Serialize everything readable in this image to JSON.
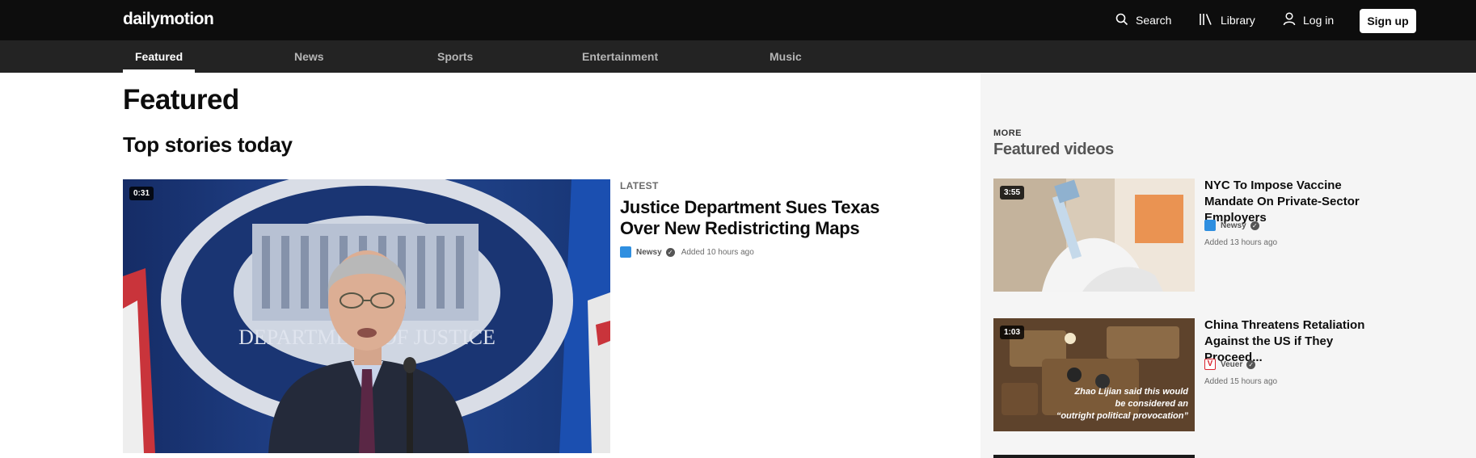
{
  "brand": {
    "logo": "dailymotion"
  },
  "topnav": {
    "search": "Search",
    "library": "Library",
    "login": "Log in",
    "signup": "Sign up"
  },
  "tabs": [
    {
      "label": "Featured",
      "active": true
    },
    {
      "label": "News"
    },
    {
      "label": "Sports"
    },
    {
      "label": "Entertainment"
    },
    {
      "label": "Music"
    }
  ],
  "main": {
    "title": "Featured",
    "section": "Top stories today",
    "hero": {
      "duration": "0:31",
      "kicker": "LATEST",
      "title": "Justice Department Sues Texas Over New Redistricting Maps",
      "channel": "Newsy",
      "added": "Added 10 hours ago",
      "image_text": "DEPARTMENT OF JUSTICE"
    }
  },
  "sidebar": {
    "kicker": "MORE",
    "title": "Featured videos",
    "videos": [
      {
        "duration": "3:55",
        "title": "NYC To Impose Vaccine Mandate On Private-Sector Employers",
        "channel": "Newsy",
        "added": "Added 13 hours ago"
      },
      {
        "duration": "1:03",
        "title": "China Threatens Retaliation Against the US if They Proceed...",
        "channel": "Veuer",
        "added": "Added 15 hours ago",
        "caption": [
          "Zhao Lijian said this would",
          "be considered an",
          "“outright political provocation”"
        ]
      }
    ]
  },
  "colors": {
    "topbar": "#0d0d0d",
    "subnav": "#232323",
    "newsy": "#2f8fe0",
    "veuer": "#d9232d"
  }
}
